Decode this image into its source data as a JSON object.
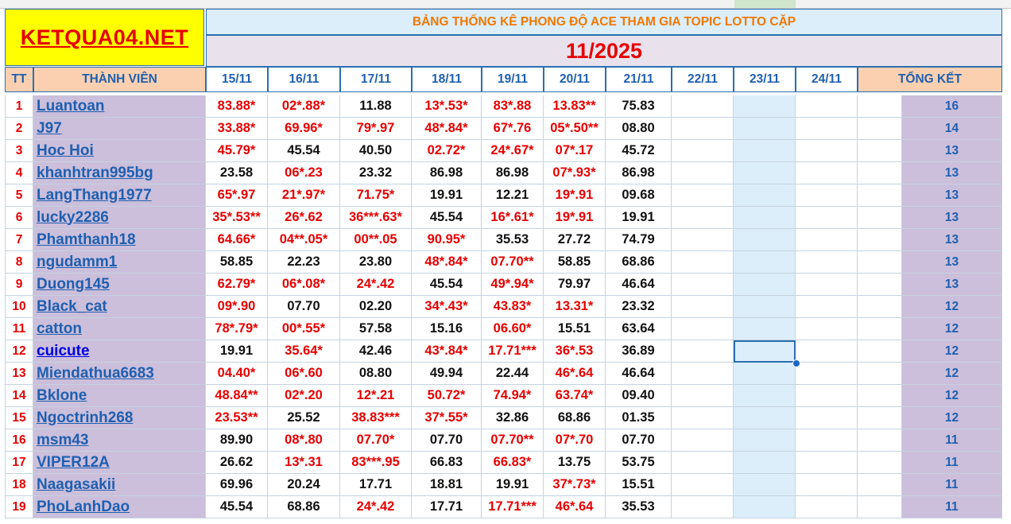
{
  "site_title": "KETQUA04.NET",
  "banner_title": "BẢNG THỐNG KÊ PHONG ĐỘ ACE THAM GIA TOPIC  LOTTO CẶP",
  "month_label": "11/2025",
  "headers": {
    "tt": "TT",
    "member": "THÀNH VIÊN",
    "dates": [
      "15/11",
      "16/11",
      "17/11",
      "18/11",
      "19/11",
      "20/11",
      "21/11",
      "22/11",
      "23/11",
      "24/11"
    ],
    "total": "TỔNG KẾT"
  },
  "rows": [
    {
      "tt": "1",
      "name": "Luantoan",
      "values": [
        "83.88*",
        "02*.88*",
        "11.88",
        "13*.53*",
        "83*.88",
        "13.83**",
        "75.83"
      ],
      "total": "16"
    },
    {
      "tt": "2",
      "name": "J97",
      "values": [
        "33.88*",
        "69.96*",
        "79*.97",
        "48*.84*",
        "67*.76",
        "05*.50**",
        "08.80"
      ],
      "total": "14"
    },
    {
      "tt": "3",
      "name": "Hoc Hoi",
      "values": [
        "45.79*",
        "45.54",
        "40.50",
        "02.72*",
        "24*.67*",
        "07*.17",
        "45.72"
      ],
      "total": "13"
    },
    {
      "tt": "4",
      "name": "khanhtran995bg",
      "values": [
        "23.58",
        "06*.23",
        "23.32",
        "86.98",
        "86.98",
        "07*.93*",
        "86.98"
      ],
      "total": "13"
    },
    {
      "tt": "5",
      "name": "LangThang1977",
      "values": [
        "65*.97",
        "21*.97*",
        "71.75*",
        "19.91",
        "12.21",
        "19*.91",
        "09.68"
      ],
      "total": "13"
    },
    {
      "tt": "6",
      "name": "lucky2286",
      "values": [
        "35*.53**",
        "26*.62",
        "36***.63*",
        "45.54",
        "16*.61*",
        "19*.91",
        "19.91"
      ],
      "total": "13"
    },
    {
      "tt": "7",
      "name": "Phamthanh18",
      "values": [
        "64.66*",
        "04**.05*",
        "00**.05",
        "90.95*",
        "35.53",
        "27.72",
        "74.79"
      ],
      "total": "13"
    },
    {
      "tt": "8",
      "name": "ngudamm1",
      "values": [
        "58.85",
        "22.23",
        "23.80",
        "48*.84*",
        "07.70**",
        "58.85",
        "68.86"
      ],
      "total": "13"
    },
    {
      "tt": "9",
      "name": "Duong145",
      "values": [
        "62.79*",
        "06*.08*",
        "24*.42",
        "45.54",
        "49*.94*",
        "79.97",
        "46.64"
      ],
      "total": "13"
    },
    {
      "tt": "10",
      "name": "Black_cat",
      "values": [
        "09*.90",
        "07.70",
        "02.20",
        "34*.43*",
        "43.83*",
        "13.31*",
        "23.32"
      ],
      "total": "12"
    },
    {
      "tt": "11",
      "name": "catton",
      "values": [
        "78*.79*",
        "00*.55*",
        "57.58",
        "15.16",
        "06.60*",
        "15.51",
        "63.64"
      ],
      "total": "12"
    },
    {
      "tt": "12",
      "name": "cuicute",
      "values": [
        "19.91",
        "35.64*",
        "42.46",
        "43*.84*",
        "17.71***",
        "36*.53",
        "36.89"
      ],
      "total": "12"
    },
    {
      "tt": "13",
      "name": "Miendathua6683",
      "values": [
        "04.40*",
        "06*.60",
        "08.80",
        "49.94",
        "22.44",
        "46*.64",
        "46.64"
      ],
      "total": "12"
    },
    {
      "tt": "14",
      "name": "Bklone",
      "values": [
        "48.84**",
        "02*.20",
        "12*.21",
        "50.72*",
        "74.94*",
        "63.74*",
        "09.40"
      ],
      "total": "12"
    },
    {
      "tt": "15",
      "name": "Ngoctrinh268",
      "values": [
        "23.53**",
        "25.52",
        "38.83***",
        "37*.55*",
        "32.86",
        "68.86",
        "01.35"
      ],
      "total": "12"
    },
    {
      "tt": "16",
      "name": "msm43",
      "values": [
        "89.90",
        "08*.80",
        "07.70*",
        "07.70",
        "07.70**",
        "07*.70",
        "07.70"
      ],
      "total": "11"
    },
    {
      "tt": "17",
      "name": "VIPER12A",
      "values": [
        "26.62",
        "13*.31",
        "83***.95",
        "66.83",
        "66.83*",
        "13.75",
        "53.75"
      ],
      "total": "11"
    },
    {
      "tt": "18",
      "name": "Naagasakii",
      "values": [
        "69.96",
        "20.24",
        "17.71",
        "18.81",
        "19.91",
        "37*.73*",
        "15.51"
      ],
      "total": "11"
    },
    {
      "tt": "19",
      "name": "PhoLanhDao",
      "values": [
        "45.54",
        "68.86",
        "24*.42",
        "17.71",
        "17.71***",
        "46*.64",
        "35.53"
      ],
      "total": "11"
    }
  ],
  "colors": {
    "accent_red": "#e60000",
    "header_blue": "#1f5fb0",
    "member_bg": "#cbbfdb",
    "title_bg": "#ffff00",
    "banner_orange": "#f07800"
  }
}
